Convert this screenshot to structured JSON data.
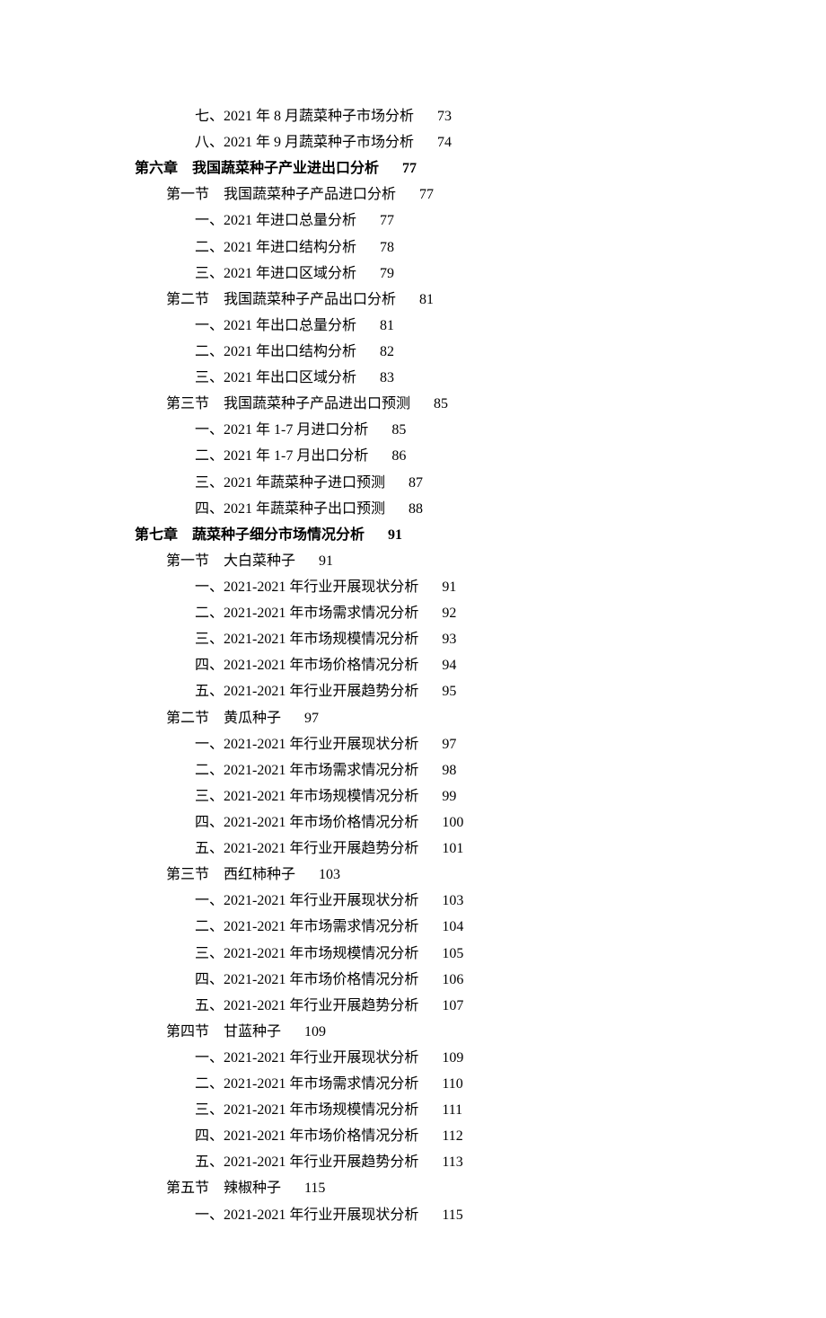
{
  "toc": [
    {
      "level": 3,
      "bold": false,
      "title": "七、2021 年 8 月蔬菜种子市场分析",
      "page": "73"
    },
    {
      "level": 3,
      "bold": false,
      "title": "八、2021 年 9 月蔬菜种子市场分析",
      "page": "74"
    },
    {
      "level": 1,
      "bold": true,
      "title": "第六章　我国蔬菜种子产业进出口分析",
      "page": "77"
    },
    {
      "level": 2,
      "bold": false,
      "title": "第一节　我国蔬菜种子产品进口分析",
      "page": "77"
    },
    {
      "level": 3,
      "bold": false,
      "title": "一、2021 年进口总量分析",
      "page": "77"
    },
    {
      "level": 3,
      "bold": false,
      "title": "二、2021 年进口结构分析",
      "page": "78"
    },
    {
      "level": 3,
      "bold": false,
      "title": "三、2021 年进口区域分析",
      "page": "79"
    },
    {
      "level": 2,
      "bold": false,
      "title": "第二节　我国蔬菜种子产品出口分析",
      "page": "81"
    },
    {
      "level": 3,
      "bold": false,
      "title": "一、2021 年出口总量分析",
      "page": "81"
    },
    {
      "level": 3,
      "bold": false,
      "title": "二、2021 年出口结构分析",
      "page": "82"
    },
    {
      "level": 3,
      "bold": false,
      "title": "三、2021 年出口区域分析",
      "page": "83"
    },
    {
      "level": 2,
      "bold": false,
      "title": "第三节　我国蔬菜种子产品进出口预测",
      "page": "85"
    },
    {
      "level": 3,
      "bold": false,
      "title": "一、2021 年 1-7 月进口分析",
      "page": "85"
    },
    {
      "level": 3,
      "bold": false,
      "title": "二、2021 年 1-7 月出口分析",
      "page": "86"
    },
    {
      "level": 3,
      "bold": false,
      "title": "三、2021 年蔬菜种子进口预测",
      "page": "87"
    },
    {
      "level": 3,
      "bold": false,
      "title": "四、2021 年蔬菜种子出口预测",
      "page": "88"
    },
    {
      "level": 1,
      "bold": true,
      "title": "第七章　蔬菜种子细分市场情况分析",
      "page": "91"
    },
    {
      "level": 2,
      "bold": false,
      "title": "第一节　大白菜种子",
      "page": "91"
    },
    {
      "level": 3,
      "bold": false,
      "title": "一、2021-2021 年行业开展现状分析",
      "page": "91"
    },
    {
      "level": 3,
      "bold": false,
      "title": "二、2021-2021 年市场需求情况分析",
      "page": "92"
    },
    {
      "level": 3,
      "bold": false,
      "title": "三、2021-2021 年市场规模情况分析",
      "page": "93"
    },
    {
      "level": 3,
      "bold": false,
      "title": "四、2021-2021 年市场价格情况分析",
      "page": "94"
    },
    {
      "level": 3,
      "bold": false,
      "title": "五、2021-2021 年行业开展趋势分析",
      "page": "95"
    },
    {
      "level": 2,
      "bold": false,
      "title": "第二节　黄瓜种子",
      "page": "97"
    },
    {
      "level": 3,
      "bold": false,
      "title": "一、2021-2021 年行业开展现状分析",
      "page": "97"
    },
    {
      "level": 3,
      "bold": false,
      "title": "二、2021-2021 年市场需求情况分析",
      "page": "98"
    },
    {
      "level": 3,
      "bold": false,
      "title": "三、2021-2021 年市场规模情况分析",
      "page": "99"
    },
    {
      "level": 3,
      "bold": false,
      "title": "四、2021-2021 年市场价格情况分析",
      "page": "100"
    },
    {
      "level": 3,
      "bold": false,
      "title": "五、2021-2021 年行业开展趋势分析",
      "page": "101"
    },
    {
      "level": 2,
      "bold": false,
      "title": "第三节　西红柿种子",
      "page": "103"
    },
    {
      "level": 3,
      "bold": false,
      "title": "一、2021-2021 年行业开展现状分析",
      "page": "103"
    },
    {
      "level": 3,
      "bold": false,
      "title": "二、2021-2021 年市场需求情况分析",
      "page": "104"
    },
    {
      "level": 3,
      "bold": false,
      "title": "三、2021-2021 年市场规模情况分析",
      "page": "105"
    },
    {
      "level": 3,
      "bold": false,
      "title": "四、2021-2021 年市场价格情况分析",
      "page": "106"
    },
    {
      "level": 3,
      "bold": false,
      "title": "五、2021-2021 年行业开展趋势分析",
      "page": "107"
    },
    {
      "level": 2,
      "bold": false,
      "title": "第四节　甘蓝种子",
      "page": "109"
    },
    {
      "level": 3,
      "bold": false,
      "title": "一、2021-2021 年行业开展现状分析",
      "page": "109"
    },
    {
      "level": 3,
      "bold": false,
      "title": "二、2021-2021 年市场需求情况分析",
      "page": "110"
    },
    {
      "level": 3,
      "bold": false,
      "title": "三、2021-2021 年市场规模情况分析",
      "page": "111"
    },
    {
      "level": 3,
      "bold": false,
      "title": "四、2021-2021 年市场价格情况分析",
      "page": "112"
    },
    {
      "level": 3,
      "bold": false,
      "title": "五、2021-2021 年行业开展趋势分析",
      "page": "113"
    },
    {
      "level": 2,
      "bold": false,
      "title": "第五节　辣椒种子",
      "page": "115"
    },
    {
      "level": 3,
      "bold": false,
      "title": "一、2021-2021 年行业开展现状分析",
      "page": "115"
    }
  ]
}
